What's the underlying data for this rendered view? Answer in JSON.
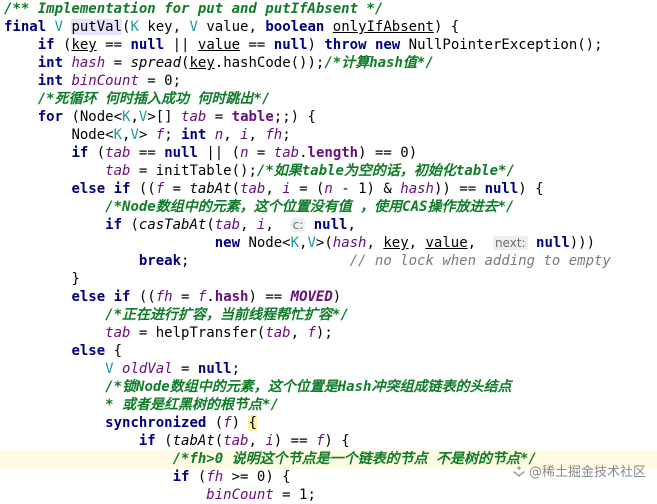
{
  "code_lines": [
    {
      "tokens": [
        {
          "t": "/** Implementation for put and putIfAbsent */",
          "c": "cm"
        }
      ]
    },
    {
      "tokens": [
        {
          "t": "final ",
          "c": "kw"
        },
        {
          "t": "V ",
          "c": "gen"
        },
        {
          "t": "putVal",
          "c": "plain mhl"
        },
        {
          "t": "(",
          "c": "plain"
        },
        {
          "t": "K ",
          "c": "gen"
        },
        {
          "t": "key, ",
          "c": "plain"
        },
        {
          "t": "V ",
          "c": "gen"
        },
        {
          "t": "value, ",
          "c": "plain"
        },
        {
          "t": "boolean ",
          "c": "kw"
        },
        {
          "t": "onlyIfAbsent",
          "c": "plain und"
        },
        {
          "t": ") {",
          "c": "plain"
        }
      ]
    },
    {
      "tokens": [
        {
          "t": "    "
        },
        {
          "t": "if ",
          "c": "kw"
        },
        {
          "t": "(",
          "c": "plain"
        },
        {
          "t": "key",
          "c": "plain und"
        },
        {
          "t": " == ",
          "c": "plain"
        },
        {
          "t": "null ",
          "c": "kw"
        },
        {
          "t": "|| ",
          "c": "plain"
        },
        {
          "t": "value",
          "c": "plain und"
        },
        {
          "t": " == ",
          "c": "plain"
        },
        {
          "t": "null",
          "c": "kw"
        },
        {
          "t": ") ",
          "c": "plain"
        },
        {
          "t": "throw new ",
          "c": "kw"
        },
        {
          "t": "NullPointerException();",
          "c": "plain"
        }
      ]
    },
    {
      "tokens": [
        {
          "t": "    "
        },
        {
          "t": "int ",
          "c": "kw"
        },
        {
          "t": "hash",
          "c": "vari"
        },
        {
          "t": " = ",
          "c": "plain"
        },
        {
          "t": "spread",
          "c": "mi"
        },
        {
          "t": "(",
          "c": "plain"
        },
        {
          "t": "key",
          "c": "plain und"
        },
        {
          "t": ".hashCode());",
          "c": "plain"
        },
        {
          "t": "/*计算hash值*/",
          "c": "cm"
        }
      ]
    },
    {
      "tokens": [
        {
          "t": "    "
        },
        {
          "t": "int ",
          "c": "kw"
        },
        {
          "t": "binCount",
          "c": "vari"
        },
        {
          "t": " = ",
          "c": "plain"
        },
        {
          "t": "0",
          "c": "plain"
        },
        {
          "t": ";",
          "c": "plain"
        }
      ]
    },
    {
      "tokens": [
        {
          "t": "    "
        },
        {
          "t": "/*死循环 何时插入成功 何时跳出*/",
          "c": "cm"
        }
      ]
    },
    {
      "tokens": [
        {
          "t": "    "
        },
        {
          "t": "for ",
          "c": "kw"
        },
        {
          "t": "(Node<",
          "c": "plain"
        },
        {
          "t": "K",
          "c": "gen"
        },
        {
          "t": ",",
          "c": "plain"
        },
        {
          "t": "V",
          "c": "gen"
        },
        {
          "t": ">[] ",
          "c": "plain"
        },
        {
          "t": "tab",
          "c": "vari"
        },
        {
          "t": " = ",
          "c": "plain"
        },
        {
          "t": "table",
          "c": "fld"
        },
        {
          "t": ";;) {",
          "c": "plain"
        }
      ]
    },
    {
      "tokens": [
        {
          "t": "        "
        },
        {
          "t": "Node<",
          "c": "plain"
        },
        {
          "t": "K",
          "c": "gen"
        },
        {
          "t": ",",
          "c": "plain"
        },
        {
          "t": "V",
          "c": "gen"
        },
        {
          "t": "> ",
          "c": "plain"
        },
        {
          "t": "f",
          "c": "vari"
        },
        {
          "t": "; ",
          "c": "plain"
        },
        {
          "t": "int ",
          "c": "kw"
        },
        {
          "t": "n",
          "c": "vari"
        },
        {
          "t": ", ",
          "c": "plain"
        },
        {
          "t": "i",
          "c": "vari"
        },
        {
          "t": ", ",
          "c": "plain"
        },
        {
          "t": "fh",
          "c": "vari"
        },
        {
          "t": ";",
          "c": "plain"
        }
      ]
    },
    {
      "tokens": [
        {
          "t": "        "
        },
        {
          "t": "if ",
          "c": "kw"
        },
        {
          "t": "(",
          "c": "plain"
        },
        {
          "t": "tab",
          "c": "vari"
        },
        {
          "t": " == ",
          "c": "plain"
        },
        {
          "t": "null ",
          "c": "kw"
        },
        {
          "t": "|| (",
          "c": "plain"
        },
        {
          "t": "n",
          "c": "vari"
        },
        {
          "t": " = ",
          "c": "plain"
        },
        {
          "t": "tab",
          "c": "vari"
        },
        {
          "t": ".",
          "c": "plain"
        },
        {
          "t": "length",
          "c": "fld"
        },
        {
          "t": ") == ",
          "c": "plain"
        },
        {
          "t": "0",
          "c": "plain"
        },
        {
          "t": ")",
          "c": "plain"
        }
      ]
    },
    {
      "tokens": [
        {
          "t": "            "
        },
        {
          "t": "tab",
          "c": "vari"
        },
        {
          "t": " = initTable();",
          "c": "plain"
        },
        {
          "t": "/*如果table为空的话，初始化table*/",
          "c": "cm"
        }
      ]
    },
    {
      "tokens": [
        {
          "t": "        "
        },
        {
          "t": "else if ",
          "c": "kw"
        },
        {
          "t": "((",
          "c": "plain"
        },
        {
          "t": "f",
          "c": "vari"
        },
        {
          "t": " = ",
          "c": "plain"
        },
        {
          "t": "tabAt",
          "c": "mi"
        },
        {
          "t": "(",
          "c": "plain"
        },
        {
          "t": "tab",
          "c": "vari"
        },
        {
          "t": ", ",
          "c": "plain"
        },
        {
          "t": "i",
          "c": "vari"
        },
        {
          "t": " = (",
          "c": "plain"
        },
        {
          "t": "n",
          "c": "vari"
        },
        {
          "t": " - ",
          "c": "plain"
        },
        {
          "t": "1",
          "c": "plain"
        },
        {
          "t": ") & ",
          "c": "plain"
        },
        {
          "t": "hash",
          "c": "vari"
        },
        {
          "t": ")) == ",
          "c": "plain"
        },
        {
          "t": "null",
          "c": "kw"
        },
        {
          "t": ") {",
          "c": "plain"
        }
      ]
    },
    {
      "tokens": [
        {
          "t": "            "
        },
        {
          "t": "/*Node数组中的元素，这个位置没有值 ，使用CAS操作放进去*/",
          "c": "cm"
        }
      ]
    },
    {
      "tokens": [
        {
          "t": "            "
        },
        {
          "t": "if ",
          "c": "kw"
        },
        {
          "t": "(",
          "c": "plain"
        },
        {
          "t": "casTabAt",
          "c": "mi"
        },
        {
          "t": "(",
          "c": "plain"
        },
        {
          "t": "tab",
          "c": "vari"
        },
        {
          "t": ", ",
          "c": "plain"
        },
        {
          "t": "i",
          "c": "vari"
        },
        {
          "t": ",  ",
          "c": "plain"
        },
        {
          "t": "c:",
          "c": "hint"
        },
        {
          "t": " ",
          "c": "plain"
        },
        {
          "t": "null",
          "c": "kw"
        },
        {
          "t": ",",
          "c": "plain"
        }
      ]
    },
    {
      "tokens": [
        {
          "t": "                         "
        },
        {
          "t": "new ",
          "c": "kw"
        },
        {
          "t": "Node<",
          "c": "plain"
        },
        {
          "t": "K",
          "c": "gen"
        },
        {
          "t": ",",
          "c": "plain"
        },
        {
          "t": "V",
          "c": "gen"
        },
        {
          "t": ">(",
          "c": "plain"
        },
        {
          "t": "hash",
          "c": "vari"
        },
        {
          "t": ", ",
          "c": "plain"
        },
        {
          "t": "key",
          "c": "plain und"
        },
        {
          "t": ", ",
          "c": "plain"
        },
        {
          "t": "value",
          "c": "plain und"
        },
        {
          "t": ",  ",
          "c": "plain"
        },
        {
          "t": "next:",
          "c": "hint"
        },
        {
          "t": " ",
          "c": "plain"
        },
        {
          "t": "null",
          "c": "kw"
        },
        {
          "t": ")))",
          "c": "plain"
        }
      ]
    },
    {
      "tokens": [
        {
          "t": "                "
        },
        {
          "t": "break",
          "c": "kw"
        },
        {
          "t": ";",
          "c": "plain"
        },
        {
          "t": "                   "
        },
        {
          "t": "// no lock when adding to empty",
          "c": "cmn"
        }
      ]
    },
    {
      "tokens": [
        {
          "t": "        "
        },
        {
          "t": "}",
          "c": "plain"
        }
      ]
    },
    {
      "tokens": [
        {
          "t": "        "
        },
        {
          "t": "else if ",
          "c": "kw"
        },
        {
          "t": "((",
          "c": "plain"
        },
        {
          "t": "fh",
          "c": "vari"
        },
        {
          "t": " = ",
          "c": "plain"
        },
        {
          "t": "f",
          "c": "vari"
        },
        {
          "t": ".",
          "c": "plain"
        },
        {
          "t": "hash",
          "c": "fld"
        },
        {
          "t": ") == ",
          "c": "plain"
        },
        {
          "t": "MOVED",
          "c": "fldi"
        },
        {
          "t": ")",
          "c": "plain"
        }
      ]
    },
    {
      "tokens": [
        {
          "t": "            "
        },
        {
          "t": "/*正在进行扩容，当前线程帮忙扩容*/",
          "c": "cm"
        }
      ]
    },
    {
      "tokens": [
        {
          "t": "            "
        },
        {
          "t": "tab",
          "c": "vari"
        },
        {
          "t": " = helpTransfer(",
          "c": "plain"
        },
        {
          "t": "tab",
          "c": "vari"
        },
        {
          "t": ", ",
          "c": "plain"
        },
        {
          "t": "f",
          "c": "vari"
        },
        {
          "t": ");",
          "c": "plain"
        }
      ]
    },
    {
      "tokens": [
        {
          "t": "        "
        },
        {
          "t": "else ",
          "c": "kw"
        },
        {
          "t": "{",
          "c": "plain"
        }
      ]
    },
    {
      "tokens": [
        {
          "t": "            "
        },
        {
          "t": "V ",
          "c": "gen"
        },
        {
          "t": "oldVal",
          "c": "vari"
        },
        {
          "t": " = ",
          "c": "plain"
        },
        {
          "t": "null",
          "c": "kw"
        },
        {
          "t": ";",
          "c": "plain"
        }
      ]
    },
    {
      "tokens": [
        {
          "t": "            "
        },
        {
          "t": "/*锁Node数组中的元素，这个位置是Hash冲突组成链表的头结点",
          "c": "cm"
        }
      ]
    },
    {
      "tokens": [
        {
          "t": "            "
        },
        {
          "t": "* 或者是红黑树的根节点*/",
          "c": "cm"
        }
      ]
    },
    {
      "tokens": [
        {
          "t": "            "
        },
        {
          "t": "synchronized ",
          "c": "kw"
        },
        {
          "t": "(",
          "c": "plain"
        },
        {
          "t": "f",
          "c": "vari"
        },
        {
          "t": ") ",
          "c": "plain"
        },
        {
          "t": "{",
          "c": "plain brace"
        }
      ]
    },
    {
      "tokens": [
        {
          "t": "                "
        },
        {
          "t": "if ",
          "c": "kw"
        },
        {
          "t": "(",
          "c": "plain"
        },
        {
          "t": "tabAt",
          "c": "mi"
        },
        {
          "t": "(",
          "c": "plain"
        },
        {
          "t": "tab",
          "c": "vari"
        },
        {
          "t": ", ",
          "c": "plain"
        },
        {
          "t": "i",
          "c": "vari"
        },
        {
          "t": ") == ",
          "c": "plain"
        },
        {
          "t": "f",
          "c": "vari"
        },
        {
          "t": ") {",
          "c": "plain"
        }
      ]
    },
    {
      "tokens": [
        {
          "t": "                    "
        },
        {
          "t": "/*fh>0 说明这个节点是一个链表的节点 不是树的节点*/",
          "c": "cm"
        }
      ]
    },
    {
      "tokens": [
        {
          "t": "                    "
        },
        {
          "t": "if ",
          "c": "kw"
        },
        {
          "t": "(",
          "c": "plain"
        },
        {
          "t": "fh",
          "c": "vari"
        },
        {
          "t": " >= ",
          "c": "plain"
        },
        {
          "t": "0",
          "c": "plain"
        },
        {
          "t": ") {",
          "c": "plain"
        }
      ]
    },
    {
      "tokens": [
        {
          "t": "                        "
        },
        {
          "t": "binCount",
          "c": "vari"
        },
        {
          "t": " = ",
          "c": "plain"
        },
        {
          "t": "1",
          "c": "plain"
        },
        {
          "t": ";",
          "c": "plain"
        }
      ]
    }
  ],
  "highlighted_line_index": 25,
  "watermark": {
    "text": "@稀土掘金技术社区",
    "color": "#8a8a8a"
  },
  "colors": {
    "keyword": "#000080",
    "comment": "#0f7c28",
    "field": "#660e7a",
    "type_param": "#20999d",
    "current_line": "#fffae3"
  }
}
